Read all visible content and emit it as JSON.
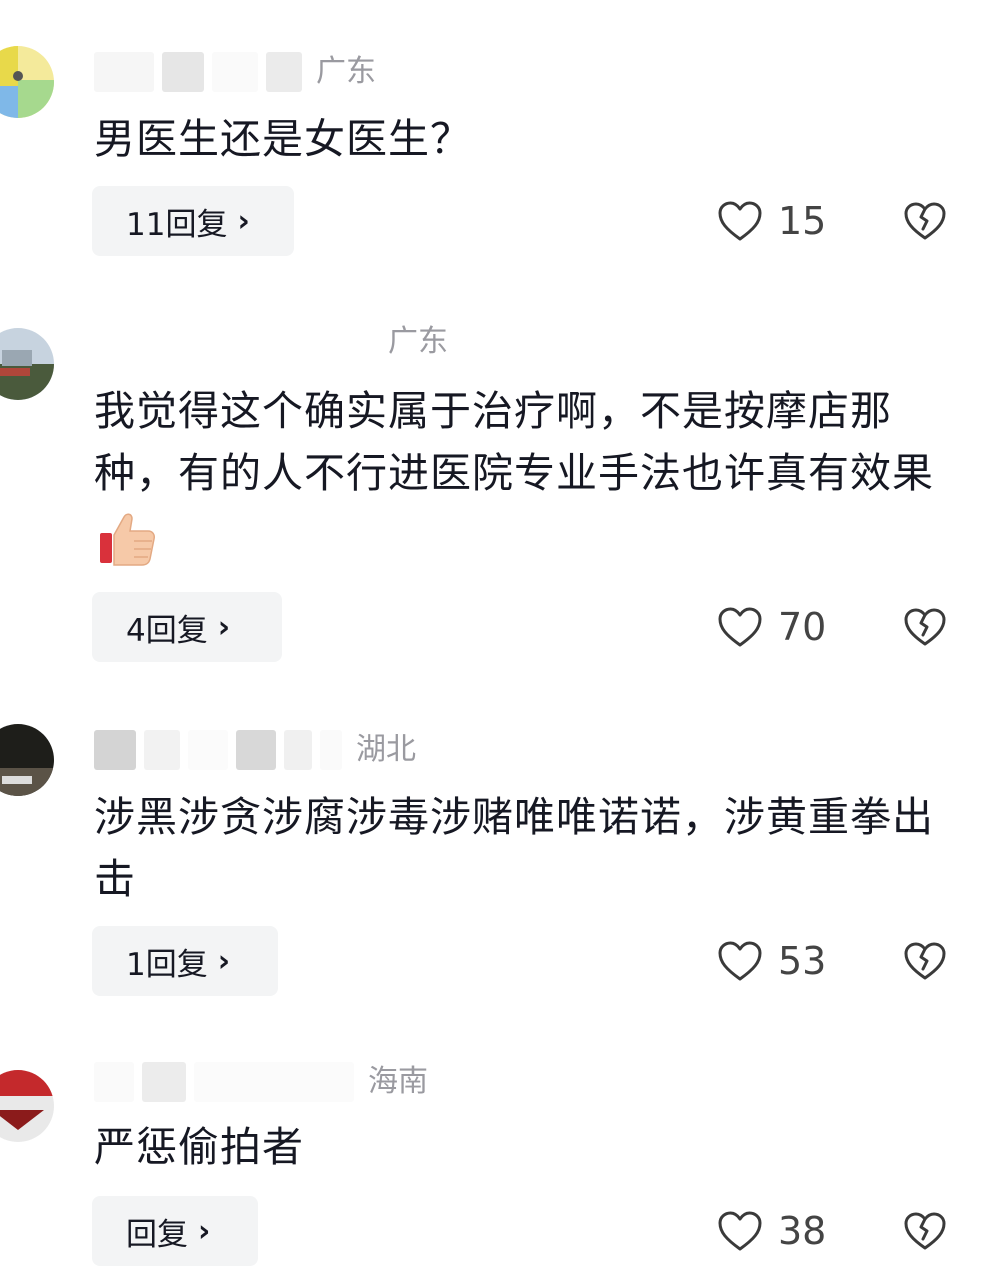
{
  "comments": [
    {
      "region": "广东",
      "text": "男医生还是女医生？",
      "reply_label": "11回复",
      "like_count": "15",
      "avatar_colors": [
        "#e8d94a",
        "#7fb8e8",
        "#8fd07a"
      ]
    },
    {
      "region": "广东",
      "text": "我觉得这个确实属于治疗啊，不是按摩店那种，有的人不行进医院专业手法也许真有效果",
      "reply_label": "4回复",
      "like_count": "70",
      "avatar_colors": [
        "#c7d3df",
        "#4a5a3c",
        "#b0463a"
      ]
    },
    {
      "region": "湖北",
      "text": "涉黑涉贪涉腐涉毒涉赌唯唯诺诺，涉黄重拳出击",
      "reply_label": "1回复",
      "like_count": "53",
      "avatar_colors": [
        "#1e1e1a",
        "#5b5347",
        "#dcdcdc"
      ]
    },
    {
      "region": "海南",
      "text": "严惩偷拍者",
      "reply_label": "回复",
      "like_count": "38",
      "avatar_colors": [
        "#c4292c",
        "#e9e9e9",
        "#8b1b1b"
      ]
    }
  ],
  "icons": {
    "chevron": "›",
    "like": "heart-outline-icon",
    "dislike": "broken-heart-icon",
    "emoji": "thumbs-up-emoji"
  }
}
